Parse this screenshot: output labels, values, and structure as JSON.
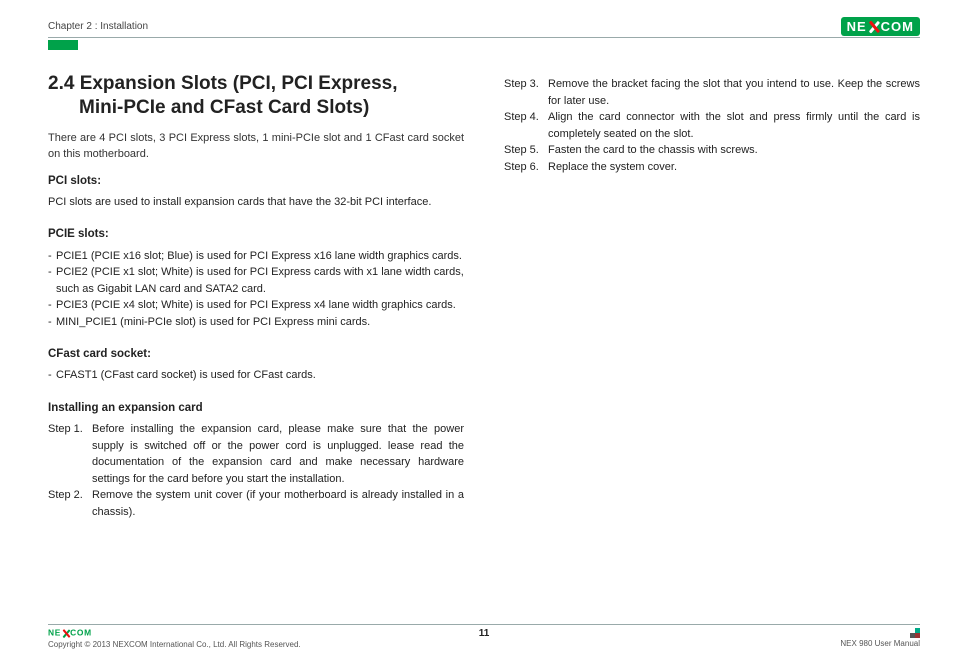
{
  "header": {
    "chapter": "Chapter 2 : Installation"
  },
  "section": {
    "title_l1": "2.4 Expansion Slots (PCI, PCI Express,",
    "title_l2": "Mini-PCIe and CFast Card Slots)",
    "intro": "There are 4 PCI slots, 3 PCI Express slots, 1 mini-PCIe slot and 1 CFast card socket on this motherboard."
  },
  "pci": {
    "heading": "PCI slots:",
    "text": "PCI slots are used to install expansion cards that have the 32-bit PCI interface."
  },
  "pcie": {
    "heading": "PCIE slots:",
    "items": [
      "PCIE1 (PCIE x16 slot; Blue) is used for PCI Express x16 lane width graphics cards.",
      "PCIE2 (PCIE x1 slot; White) is used for PCI Express cards with x1 lane width cards, such as Gigabit LAN card and SATA2 card.",
      "PCIE3 (PCIE x4 slot; White) is used for PCI Express x4 lane width graphics cards.",
      "MINI_PCIE1 (mini-PCIe slot) is used for PCI Express mini cards."
    ]
  },
  "cfast": {
    "heading": "CFast card socket:",
    "item": "CFAST1 (CFast card socket) is used for CFast cards."
  },
  "install": {
    "heading": "Installing an expansion card",
    "steps_left": [
      {
        "label": "Step 1.",
        "text": "Before installing the expansion card, please make sure that the power supply is switched off or the power cord is unplugged. lease read the documentation of the expansion card and make necessary hardware settings for the card before you start the installation."
      },
      {
        "label": "Step 2.",
        "text": "Remove the system unit cover (if your motherboard is already installed in a chassis)."
      }
    ],
    "steps_right": [
      {
        "label": "Step 3.",
        "text": "Remove the bracket facing the slot that you intend to use. Keep the screws for later use."
      },
      {
        "label": "Step 4.",
        "text": "Align the card connector with the slot and press firmly until the card is completely seated on the slot."
      },
      {
        "label": "Step 5.",
        "text": "Fasten the card to the chassis with screws."
      },
      {
        "label": "Step 6.",
        "text": "Replace the system cover."
      }
    ]
  },
  "footer": {
    "copyright": "Copyright © 2013 NEXCOM International Co., Ltd. All Rights Reserved.",
    "page": "11",
    "manual": "NEX 980 User Manual"
  },
  "logo": {
    "left": "NE",
    "right": "COM"
  }
}
